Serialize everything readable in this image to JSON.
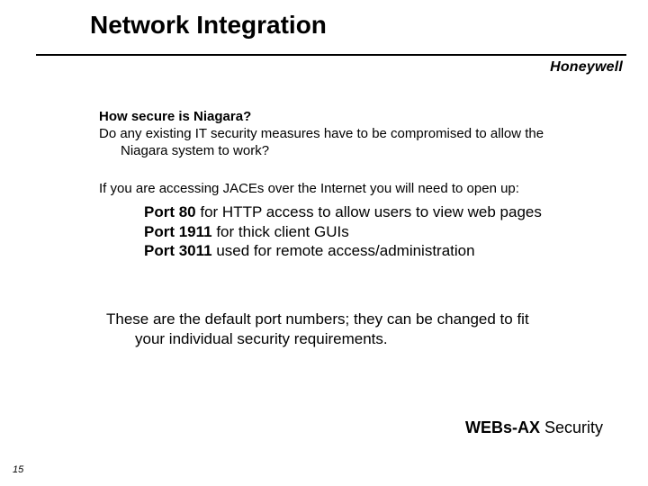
{
  "title": "Network Integration",
  "brand": "Honeywell",
  "q1": "How secure is Niagara?",
  "q2_line1": "Do any existing IT security measures have to be compromised to allow the",
  "q2_line2": "Niagara system to work?",
  "intro": "If you are accessing JACEs over the Internet you will need to open up:",
  "ports": [
    {
      "label": "Port 80",
      "desc": " for HTTP access to allow users to view web pages"
    },
    {
      "label": "Port 1911",
      "desc": " for thick client GUIs"
    },
    {
      "label": "Port 3011",
      "desc": " used for remote access/administration"
    }
  ],
  "note_line1": "These are the default port numbers; they can be changed to fit",
  "note_line2": "your individual security requirements.",
  "footer_bold": "WEBs-AX",
  "footer_rest": " Security",
  "page_number": "15"
}
